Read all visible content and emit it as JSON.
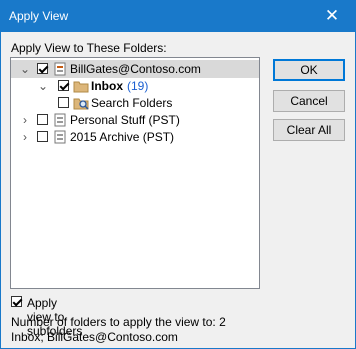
{
  "window": {
    "title": "Apply View"
  },
  "labels": {
    "apply_to_folders": "Apply View to These Folders:",
    "apply_subfolders": "Apply view to subfolders",
    "count_label": "Number of folders to apply the view to: 2",
    "folders_list": "Inbox; BillGates@Contoso.com"
  },
  "buttons": {
    "ok": "OK",
    "cancel": "Cancel",
    "clear_all": "Clear All"
  },
  "tree": {
    "items": [
      {
        "label": "BillGates@Contoso.com",
        "checked": true,
        "expanded": true,
        "icon": "mailbox-icon"
      },
      {
        "label": "Inbox",
        "count": "(19)",
        "checked": true,
        "icon": "folder-icon"
      },
      {
        "label": "Search Folders",
        "checked": false,
        "icon": "search-folder-icon"
      },
      {
        "label": "Personal Stuff (PST)",
        "checked": false,
        "expanded": false,
        "icon": "data-file-icon"
      },
      {
        "label": "2015 Archive (PST)",
        "checked": false,
        "expanded": false,
        "icon": "data-file-icon"
      }
    ]
  },
  "options": {
    "apply_subfolders_checked": true
  },
  "colors": {
    "titlebar": "#1979ca",
    "count": "#1a5fd1",
    "default_button_border": "#0078d7"
  }
}
